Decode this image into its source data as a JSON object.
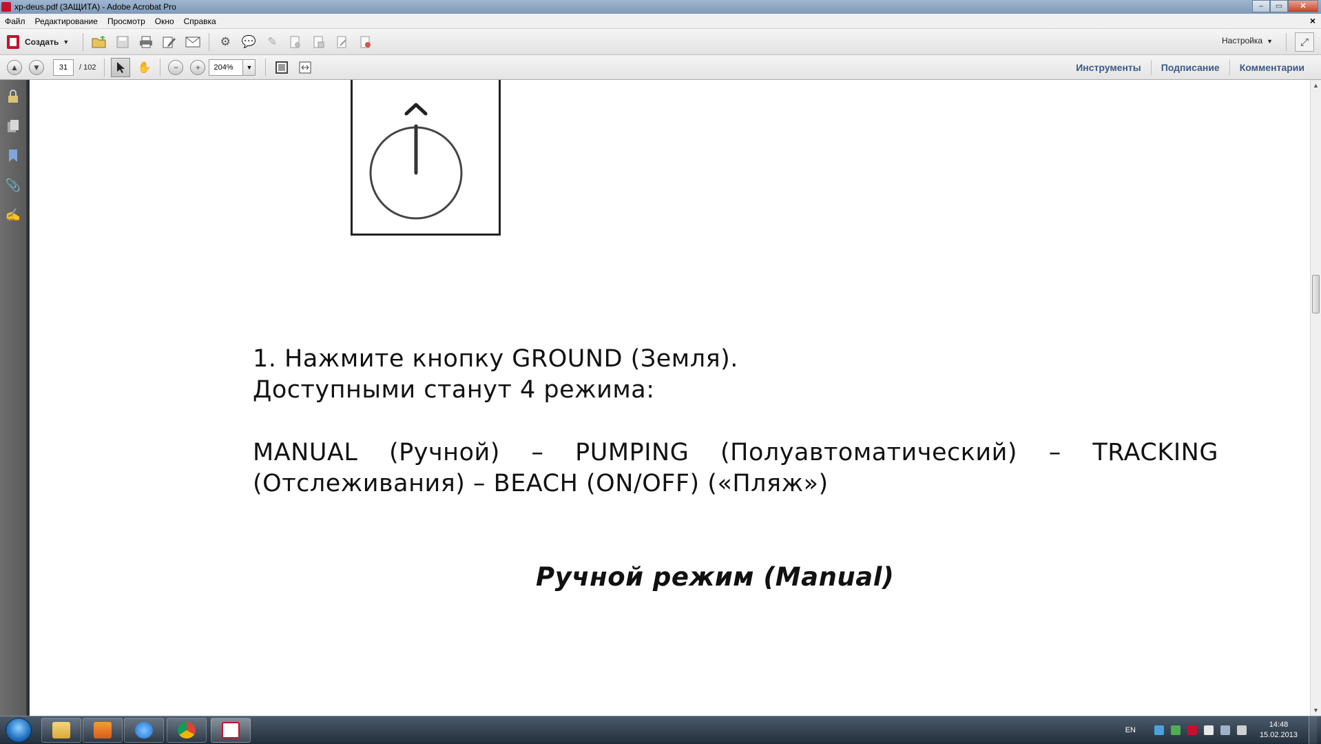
{
  "window": {
    "title": "xp-deus.pdf (ЗАЩИТА) - Adobe Acrobat Pro",
    "minimize_glyph": "‒",
    "maximize_glyph": "▭",
    "close_glyph": "✕"
  },
  "menu": {
    "items": [
      "Файл",
      "Редактирование",
      "Просмотр",
      "Окно",
      "Справка"
    ],
    "doc_close_glyph": "×"
  },
  "toolbar": {
    "create_label": "Создать",
    "settings_label": "Настройка",
    "icons": [
      "open-folder-icon",
      "save-icon",
      "print-icon",
      "edit-icon",
      "email-icon",
      "gear-icon",
      "comment-icon",
      "highlight-icon",
      "doc-export-icon",
      "doc-combine-icon",
      "doc-edit-icon",
      "doc-delete-icon"
    ]
  },
  "nav": {
    "current_page": "31",
    "total_pages": "/ 102",
    "zoom": "204%"
  },
  "panel_tabs": [
    "Инструменты",
    "Подписание",
    "Комментарии"
  ],
  "document": {
    "step1": "1.  Нажмите кнопку GROUND (Земля).",
    "step1_cont": "Доступными станут 4 режима:",
    "modes_line1": [
      "MANUAL",
      "(Ручной)",
      "–",
      "PUMPING",
      "(Полуавтоматический)",
      "–",
      "TRACKING"
    ],
    "modes_line2": "(Отслеживания) – BEACH (ON/OFF) («Пляж»)",
    "section_heading": "Ручной режим (Manual)"
  },
  "taskbar": {
    "apps": [
      "explorer",
      "media-player",
      "internet-explorer",
      "chrome",
      "acrobat"
    ],
    "language": "EN",
    "time": "14:48",
    "date": "15.02.2013"
  }
}
